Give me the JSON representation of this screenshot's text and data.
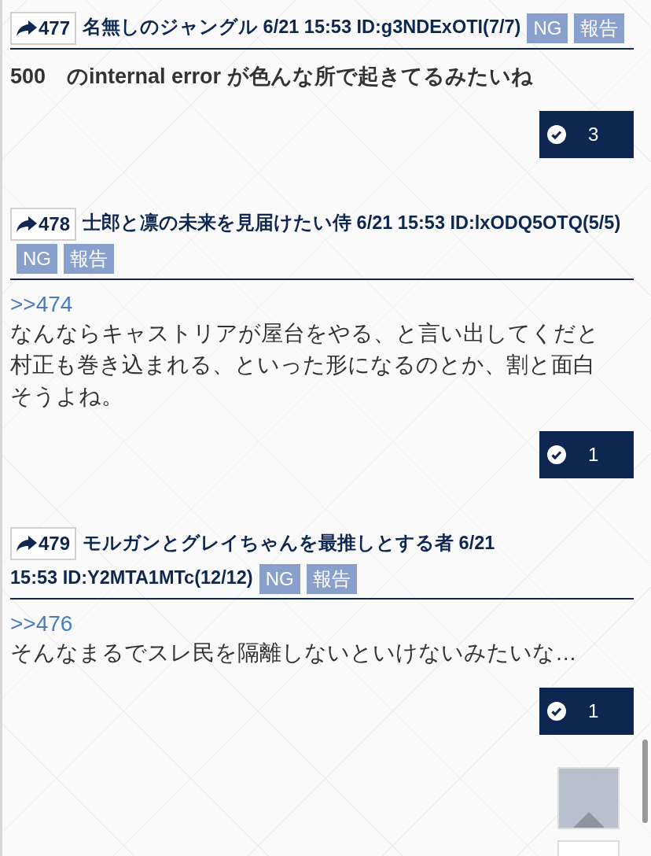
{
  "posts": [
    {
      "number": "477",
      "name": "名無しのジャングル",
      "date": "6/21",
      "time": "15:53",
      "id": "ID:g3NDExOTI(7/7)",
      "ng": "NG",
      "report": "報告",
      "body": "500　のinternal error が色んな所で起きてるみたいね",
      "kind": "emphasis",
      "likes": "3"
    },
    {
      "number": "478",
      "name": "士郎と凛の未来を見届けたい侍",
      "date": "6/21",
      "time": "15:53",
      "id": "ID:lxODQ5OTQ(5/5)",
      "ng": "NG",
      "report": "報告",
      "reply_to": ">>474",
      "body": "なんならキャストリアが屋台をやる、と言い出してくだと村正も巻き込まれる、といった形になるのとか、割と面白そうよね。",
      "kind": "plain",
      "likes": "1"
    },
    {
      "number": "479",
      "name": "モルガンとグレイちゃんを最推しとする者",
      "date": "6/21",
      "time": "15:53",
      "id": "ID:Y2MTA1MTc(12/12)",
      "ng": "NG",
      "report": "報告",
      "reply_to": ">>476",
      "body": "そんなまるでスレ民を隔離しないといけないみたいな…",
      "kind": "plain",
      "likes": "1"
    }
  ]
}
